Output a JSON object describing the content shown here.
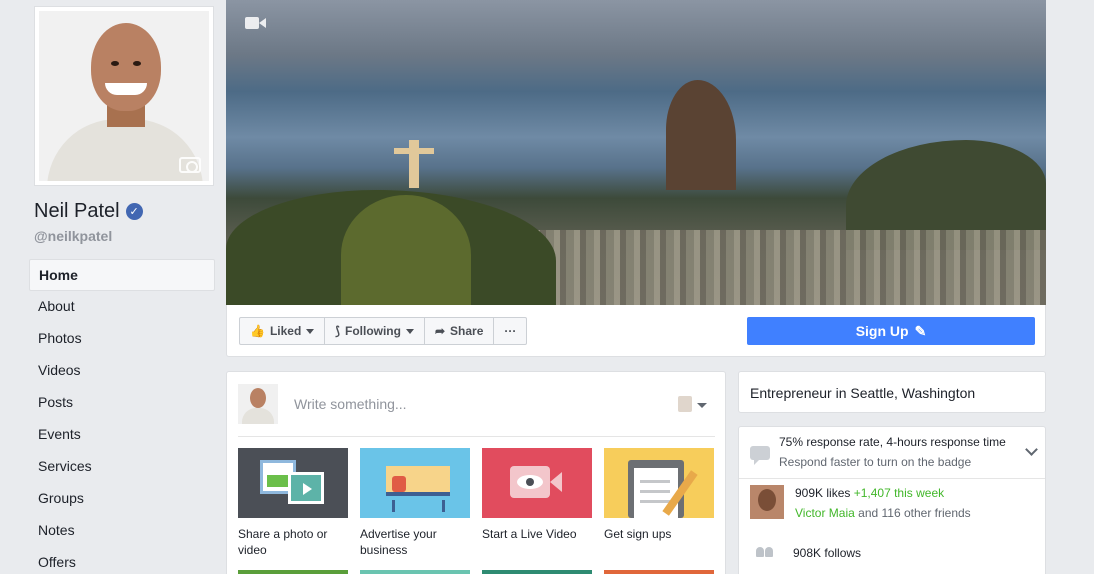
{
  "profile": {
    "name": "Neil Patel",
    "handle": "@neilkpatel",
    "verified_badge_icon": "check-icon"
  },
  "nav": {
    "items": [
      {
        "label": "Home",
        "active": true
      },
      {
        "label": "About"
      },
      {
        "label": "Photos"
      },
      {
        "label": "Videos"
      },
      {
        "label": "Posts"
      },
      {
        "label": "Events"
      },
      {
        "label": "Services"
      },
      {
        "label": "Groups"
      },
      {
        "label": "Notes"
      },
      {
        "label": "Offers"
      }
    ]
  },
  "action_bar": {
    "liked_label": "Liked",
    "following_label": "Following",
    "share_label": "Share",
    "more_label": "···",
    "signup_label": "Sign Up"
  },
  "composer": {
    "placeholder": "Write something...",
    "tiles": [
      {
        "label": "Share a photo or video"
      },
      {
        "label": "Advertise your business"
      },
      {
        "label": "Start a Live Video"
      },
      {
        "label": "Get sign ups"
      }
    ]
  },
  "about": {
    "category": "Entrepreneur in Seattle, Washington"
  },
  "info": {
    "response_rate": "75% response rate, 4-hours response time",
    "response_hint": "Respond faster to turn on the badge",
    "likes_count": "909K likes",
    "likes_growth": "+1,407 this week",
    "friend_name": "Victor Maia",
    "friends_rest": "and 116 other friends",
    "follows": "908K follows"
  },
  "colors": {
    "signup_blue": "#4080ff",
    "verified_blue": "#4267b2",
    "growth_green": "#42b72a",
    "page_bg": "#e9ebee"
  }
}
